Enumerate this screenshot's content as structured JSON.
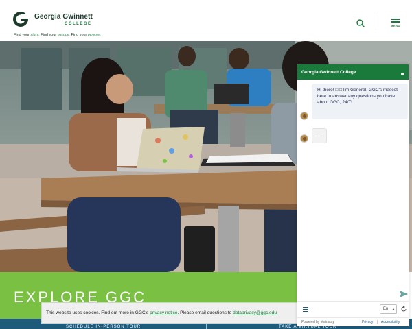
{
  "header": {
    "logo_name": "Georgia Gwinnett",
    "logo_college": "COLLEGE",
    "tagline": {
      "part1": "Find your ",
      "word1": "place.",
      "part2": " Find your ",
      "word2": "passion.",
      "part3": " Find your ",
      "word3": "purpose."
    },
    "menu_label": "MENU"
  },
  "hero": {
    "title": "EXPLORE GGC",
    "link_left": "SCHEDULE IN-PERSON TOUR",
    "link_right": "TAKE A VIRTUAL TOUR"
  },
  "cookie": {
    "text_before": "This website uses cookies. Find out more in GGC's ",
    "privacy_link": "privacy notice",
    "text_middle": ". Please email questions to ",
    "email_link": "dataprivacy@ggc.edu"
  },
  "chat": {
    "title": "Georgia Gwinnett College",
    "message": "Hi there! □ □ I'm General, GGC's mascot here to answer any questions you have about GGC, 24/7!",
    "language": "En",
    "powered_by": "Powered by Mainstay",
    "privacy": "Privacy",
    "separator": "|",
    "accessibility": "Accessibility"
  },
  "colors": {
    "brand_green": "#1a7a3c",
    "explore_green": "#7ac143",
    "bottom_blue": "#1e5a7a"
  },
  "icons": [
    "ggc-logo-icon",
    "search-icon",
    "menu-icon",
    "minimize-icon",
    "mascot-avatar-icon",
    "send-icon",
    "chat-menu-icon",
    "refresh-icon"
  ]
}
